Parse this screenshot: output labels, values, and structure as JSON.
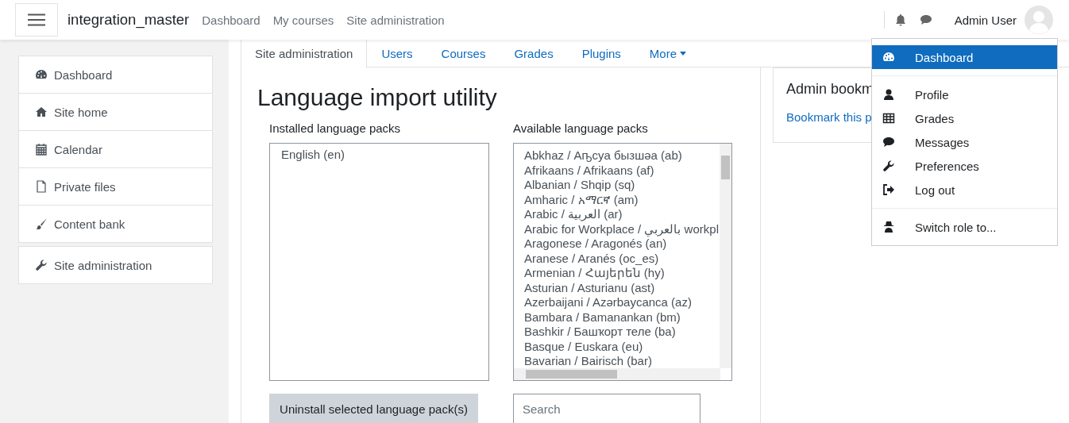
{
  "navbar": {
    "site_name": "integration_master",
    "links": [
      "Dashboard",
      "My courses",
      "Site administration"
    ],
    "user_name": "Admin User"
  },
  "sidebar": {
    "groups": [
      [
        {
          "label": "Dashboard",
          "selected": false
        },
        {
          "label": "Site home",
          "selected": false
        },
        {
          "label": "Calendar",
          "selected": false
        },
        {
          "label": "Private files",
          "selected": false
        },
        {
          "label": "Content bank",
          "selected": false
        }
      ],
      [
        {
          "label": "Site administration",
          "selected": false
        }
      ]
    ]
  },
  "tabs": [
    {
      "label": "Site administration",
      "selected": true
    },
    {
      "label": "Users",
      "selected": false
    },
    {
      "label": "Courses",
      "selected": false
    },
    {
      "label": "Grades",
      "selected": false
    },
    {
      "label": "Plugins",
      "selected": false
    },
    {
      "label": "More",
      "selected": false,
      "kind": "dropdown"
    }
  ],
  "page_title": "Language import utility",
  "installed": {
    "label": "Installed language packs",
    "items": [
      "English (en)"
    ],
    "button": "Uninstall selected language pack(s)"
  },
  "available": {
    "label": "Available language packs",
    "items": [
      "Abkhaz / Аҧсуа бызшәа (ab)",
      "Afrikaans / Afrikaans (af)",
      "Albanian / Shqip (sq)",
      "Amharic / አማርኛ (am)",
      "Arabic / العربية (ar)",
      "Arabic for Workplace / بالعربي workpl",
      "Aragonese / Aragonés (an)",
      "Aranese / Aranés (oc_es)",
      "Armenian / Հայերեն (hy)",
      "Asturian / Asturianu (ast)",
      "Azerbaijani / Azərbaycanca (az)",
      "Bambara / Bamanankan (bm)",
      "Bashkir / Башҡорт теле (ba)",
      "Basque / Euskara (eu)",
      "Bavarian / Bairisch (bar)"
    ],
    "search": {
      "placeholder": "Search"
    }
  },
  "admin_block": {
    "title": "Admin bookm",
    "link": "Bookmark this p"
  },
  "user_menu": {
    "groups": [
      [
        {
          "label": "Dashboard",
          "selected": true
        }
      ],
      [
        {
          "label": "Profile",
          "selected": false
        },
        {
          "label": "Grades",
          "selected": false
        },
        {
          "label": "Messages",
          "selected": false
        },
        {
          "label": "Preferences",
          "selected": false
        },
        {
          "label": "Log out",
          "selected": false
        }
      ],
      [
        {
          "label": "Switch role to...",
          "selected": false
        }
      ]
    ]
  }
}
